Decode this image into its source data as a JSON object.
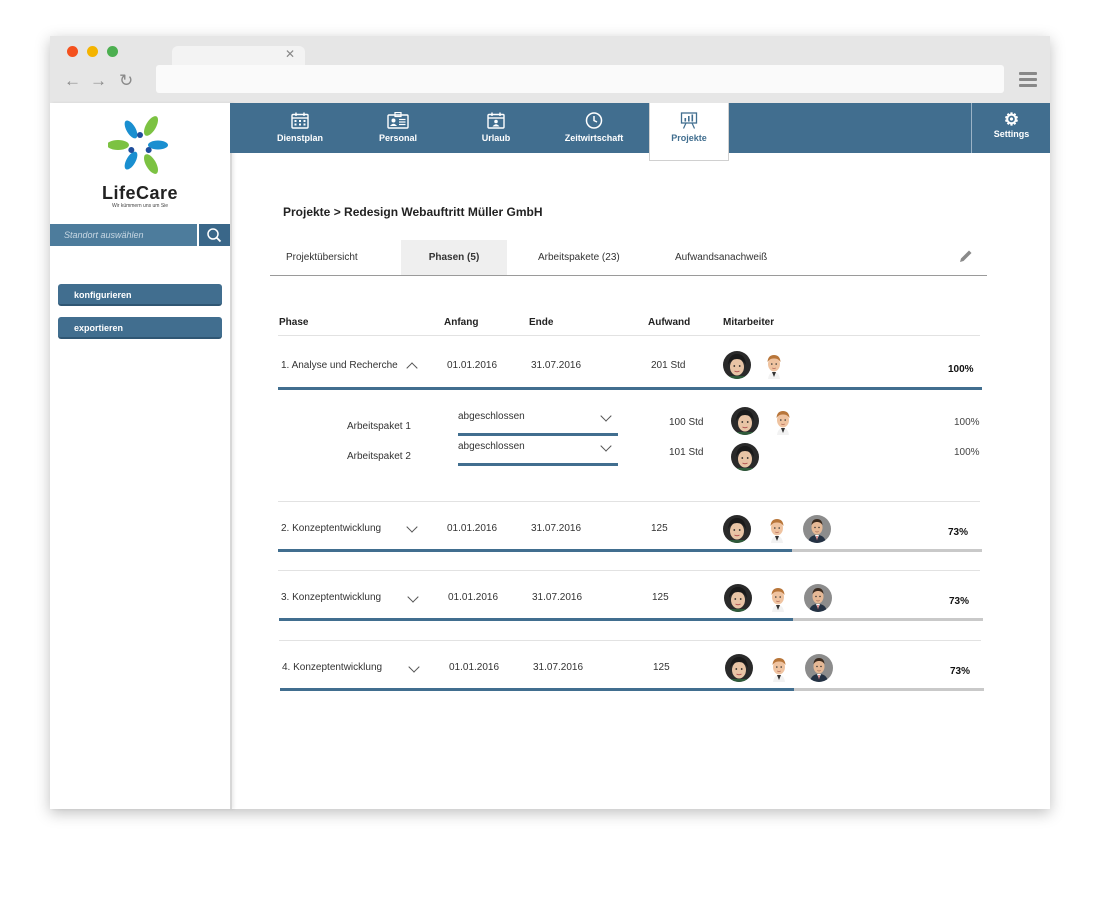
{
  "browser": {
    "colors": {
      "close": "#f4511e",
      "minimize": "#f4b400",
      "maximize": "#4caf50"
    }
  },
  "brand": {
    "name": "LifeCare",
    "tagline": "Wir kümmern uns um Sie"
  },
  "search": {
    "placeholder": "Standort auswählen"
  },
  "sidebar": {
    "buttons": [
      "konfigurieren",
      "exportieren"
    ]
  },
  "topnav": {
    "items": [
      {
        "label": "Dienstplan",
        "icon": "calendar-icon"
      },
      {
        "label": "Personal",
        "icon": "id-card-icon"
      },
      {
        "label": "Urlaub",
        "icon": "calendar-person-icon"
      },
      {
        "label": "Zeitwirtschaft",
        "icon": "clock-icon"
      },
      {
        "label": "Projekte",
        "icon": "presentation-icon",
        "active": true
      }
    ],
    "settings": "Settings"
  },
  "breadcrumb": "Projekte > Redesign Webauftritt Müller GmbH",
  "tabs": [
    "Projektübersicht",
    "Phasen (5)",
    "Arbeitspakete (23)",
    "Aufwandsanachweiß"
  ],
  "table": {
    "headers": [
      "Phase",
      "Anfang",
      "Ende",
      "Aufwand",
      "Mitarbeiter"
    ],
    "phases": [
      {
        "name": "1. Analyse und Recherche",
        "start": "01.01.2016",
        "end": "31.07.2016",
        "effort": "201 Std",
        "progress_label": "100%",
        "progress": 1.0,
        "expanded": true
      },
      {
        "name": "2. Konzeptentwicklung",
        "start": "01.01.2016",
        "end": "31.07.2016",
        "effort": "125",
        "progress_label": "73%",
        "progress": 0.73
      },
      {
        "name": "3. Konzeptentwicklung",
        "start": "01.01.2016",
        "end": "31.07.2016",
        "effort": "125",
        "progress_label": "73%",
        "progress": 0.73
      },
      {
        "name": "4. Konzeptentwicklung",
        "start": "01.01.2016",
        "end": "31.07.2016",
        "effort": "125",
        "progress_label": "73%",
        "progress": 0.73
      }
    ],
    "work_packages": [
      {
        "name": "Arbeitspaket 1",
        "status": "abgeschlossen",
        "effort": "100 Std",
        "progress_label": "100%"
      },
      {
        "name": "Arbeitspaket 2",
        "status": "abgeschlossen",
        "effort": "101 Std",
        "progress_label": "100%"
      }
    ]
  },
  "colors": {
    "primary": "#416e8f",
    "bar_track": "#c9c9c9"
  }
}
